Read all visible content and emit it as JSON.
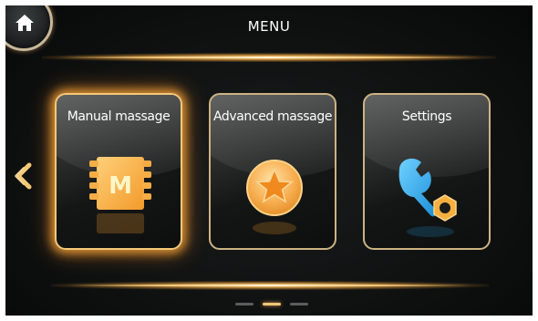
{
  "header": {
    "title": "MENU"
  },
  "navigation": {
    "home_icon": "home-icon",
    "prev_icon": "chevron-left-icon"
  },
  "tiles": [
    {
      "label": "Manual massage",
      "icon": "manual-m-icon",
      "selected": true
    },
    {
      "label": "Advanced massage",
      "icon": "star-coin-icon",
      "selected": false
    },
    {
      "label": "Settings",
      "icon": "wrench-nut-icon",
      "selected": false
    }
  ],
  "pager": {
    "pages": 3,
    "current": 2
  },
  "colors": {
    "accent": "#f2c57a",
    "background": "#0f1111",
    "tile_border": "#cdb383"
  }
}
